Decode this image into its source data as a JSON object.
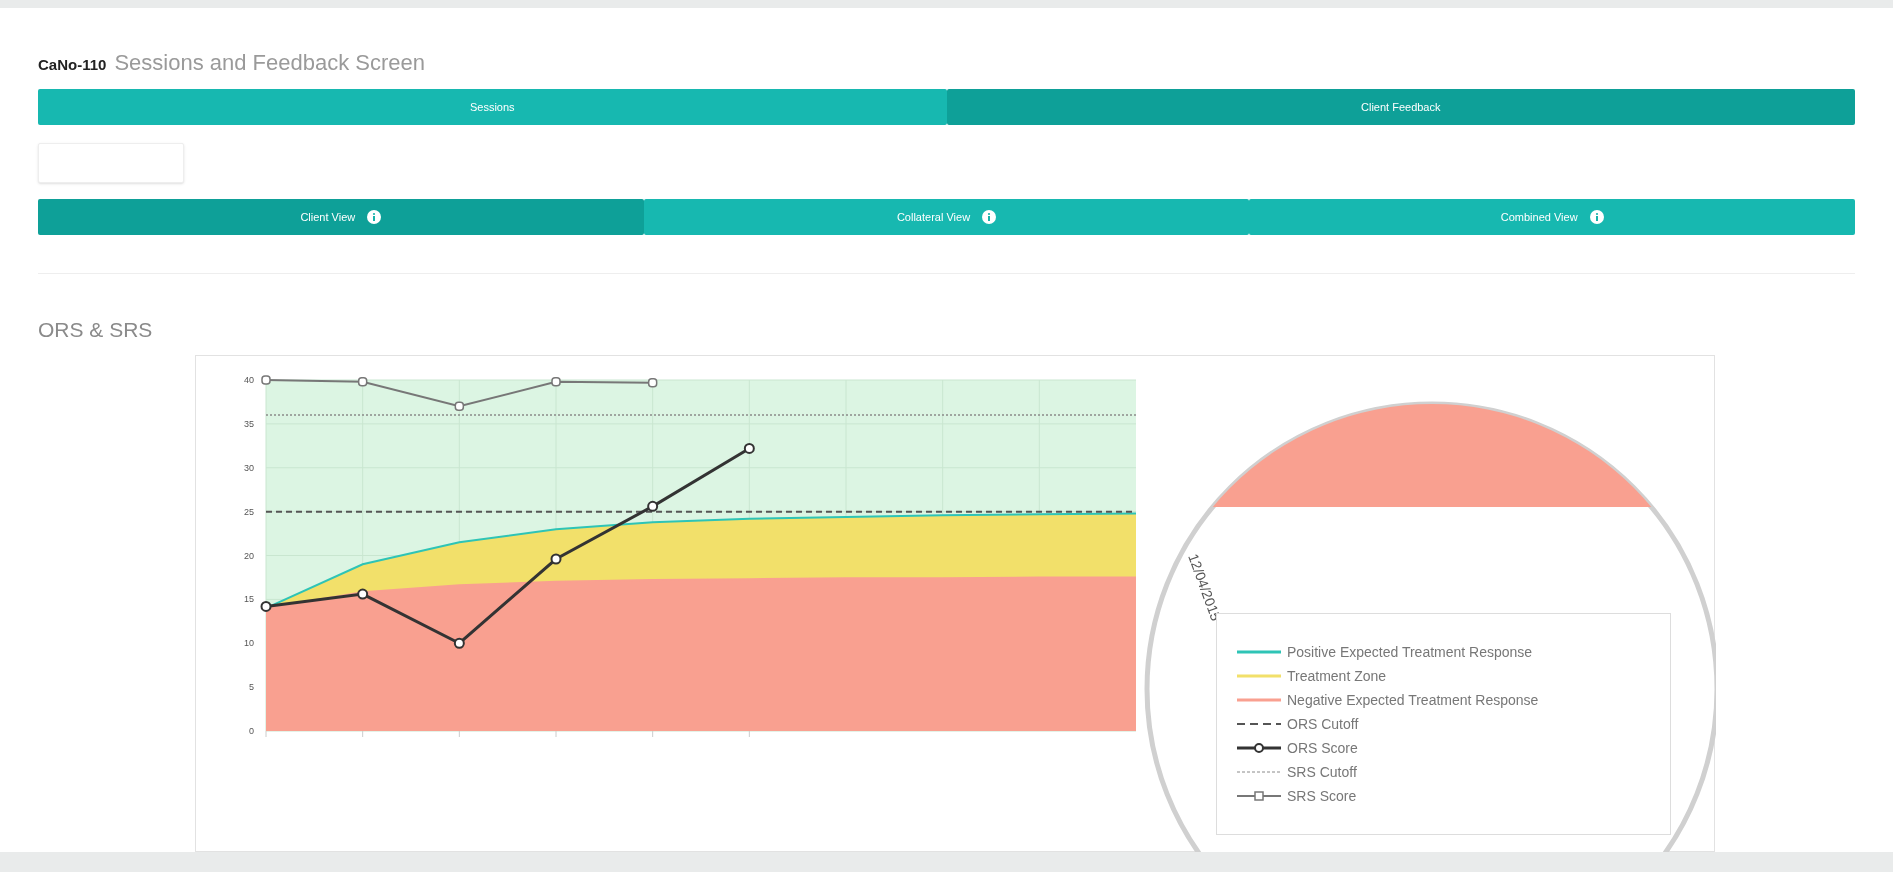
{
  "header": {
    "code": "CaNo-110",
    "title": "Sessions and Feedback Screen"
  },
  "main_tabs": [
    {
      "label": "Sessions",
      "selected": false
    },
    {
      "label": "Client Feedback",
      "selected": true
    }
  ],
  "view_tabs": [
    {
      "label": "Client View",
      "selected": true
    },
    {
      "label": "Collateral View",
      "selected": false
    },
    {
      "label": "Combined View",
      "selected": false
    }
  ],
  "section_title": "ORS & SRS",
  "chart": {
    "magnifier_date": "12/04/2015",
    "chart_data": {
      "type": "line",
      "ylim": [
        0,
        40
      ],
      "yticks": [
        0,
        5,
        10,
        15,
        20,
        25,
        30,
        35,
        40
      ],
      "grid": true,
      "series": [
        {
          "name": "Positive Expected Treatment Response",
          "color": "#2ec4b6",
          "values": [
            14,
            19,
            21.5,
            23,
            23.8,
            24.2,
            24.4,
            24.6,
            24.7,
            24.8
          ]
        },
        {
          "name": "Treatment Zone",
          "color": "#f2e06a",
          "type": "area",
          "values": [
            14,
            19,
            21.5,
            23,
            23.8,
            24.2,
            24.4,
            24.6,
            24.7,
            24.8
          ]
        },
        {
          "name": "Negative Expected Treatment Response",
          "color": "#f9a090",
          "type": "area",
          "values": [
            14,
            15.8,
            16.6,
            17,
            17.2,
            17.3,
            17.4,
            17.4,
            17.5,
            17.5
          ]
        },
        {
          "name": "ORS Cutoff",
          "color": "#555555",
          "line_style": "dashed",
          "values": [
            25,
            25,
            25,
            25,
            25,
            25,
            25,
            25,
            25,
            25
          ]
        },
        {
          "name": "ORS Score",
          "color": "#333333",
          "marker": "circle",
          "values": [
            14.2,
            15.6,
            10,
            19.6,
            25.6,
            32.2,
            null,
            null,
            null,
            null
          ]
        },
        {
          "name": "SRS Cutoff",
          "color": "#8a8a8a",
          "line_style": "dotted",
          "values": [
            36,
            36,
            36,
            36,
            36,
            36,
            36,
            36,
            36,
            36
          ]
        },
        {
          "name": "SRS Score",
          "color": "#777777",
          "marker": "square",
          "values": [
            40,
            39.8,
            37,
            39.8,
            39.7,
            null,
            null,
            null,
            null,
            null
          ]
        }
      ]
    }
  }
}
